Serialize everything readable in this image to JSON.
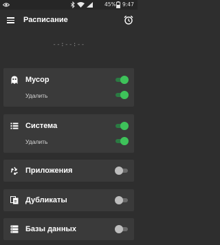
{
  "status_bar": {
    "icons": [
      "eye-icon",
      "bluetooth-icon",
      "wifi-icon",
      "signal-icon",
      "battery-icon"
    ],
    "battery": "45%",
    "time": "9:47"
  },
  "app_bar": {
    "title": "Расписание",
    "menu_icon": "menu-icon",
    "alarm_icon": "alarm-clock-icon"
  },
  "countdown": "--:--:--",
  "cards": {
    "trash": {
      "title": "Мусор",
      "icon": "ghost-icon",
      "enabled": true,
      "sub_label": "Удалить",
      "sub_enabled": true
    },
    "system": {
      "title": "Система",
      "icon": "list-icon",
      "enabled": true,
      "sub_label": "Удалить",
      "sub_enabled": true
    },
    "apps": {
      "title": "Приложения",
      "icon": "recycle-icon",
      "enabled": false
    },
    "duplicates": {
      "title": "Дубликаты",
      "icon": "duplicates-icon",
      "enabled": false
    },
    "databases": {
      "title": "Базы данных",
      "icon": "database-icon",
      "enabled": false
    }
  },
  "colors": {
    "background": "#2e2e2e",
    "card": "#3a3a3a",
    "toggle_on": "#3ec25a",
    "toggle_off": "#bdbdbd"
  }
}
